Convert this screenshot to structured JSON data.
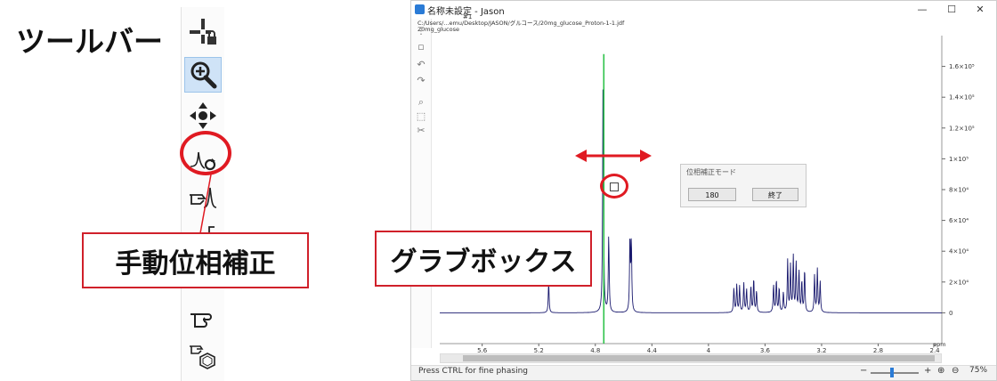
{
  "annotations": {
    "toolbar_label": "ツールバー",
    "manual_phase_label": "手動位相補正",
    "grab_box_label": "グラブボックス"
  },
  "left_toolbar": {
    "buttons": [
      {
        "icon": "crosshair-lock-icon"
      },
      {
        "icon": "zoom-in-icon",
        "active": true
      },
      {
        "icon": "move-arrows-icon"
      },
      {
        "icon": "manual-phase-icon"
      },
      {
        "icon": "hand-peak-icon"
      },
      {
        "icon": "hand-bracket-icon"
      },
      {
        "icon": "hand-point-icon"
      },
      {
        "icon": "hand-hexagon-icon"
      }
    ]
  },
  "window": {
    "title": "名称未設定 - Jason",
    "tab_label": "#1",
    "file_path": "C:/Users/...emu/Desktop/JASON/グルコース/20mg_glucose_Proton-1-1.jdf",
    "sample_name": "20mg_glucose",
    "controls": {
      "minimize": "—",
      "maximize": "☐",
      "close": "✕"
    }
  },
  "dialog": {
    "title": "位相補正モード",
    "value_button": "180",
    "finish_button": "終了"
  },
  "status": {
    "text": "Press CTRL for fine phasing",
    "zoom_minus": "−",
    "zoom_plus": "+",
    "zoom_level": "75%"
  },
  "colors": {
    "spectrum": "#1a1a6e",
    "phase_line": "#2ec24a",
    "annotation_red": "#e01a22"
  },
  "chart_data": {
    "type": "line",
    "xlabel": "ppm",
    "x_reversed": true,
    "xlim": [
      5.9,
      2.35
    ],
    "ylim": [
      -20000,
      180000
    ],
    "x_ticks": [
      {
        "v": 5.6,
        "label": "5.6"
      },
      {
        "v": 5.2,
        "label": "5.2"
      },
      {
        "v": 4.8,
        "label": "4.8"
      },
      {
        "v": 4.4,
        "label": "4.4"
      },
      {
        "v": 4.0,
        "label": "4"
      },
      {
        "v": 3.6,
        "label": "3.6"
      },
      {
        "v": 3.2,
        "label": "3.2"
      },
      {
        "v": 2.8,
        "label": "2.8"
      },
      {
        "v": 2.4,
        "label": "2.4"
      }
    ],
    "y_ticks": [
      {
        "v": 0,
        "label": "0"
      },
      {
        "v": 20000,
        "label": "2×10⁴"
      },
      {
        "v": 40000,
        "label": "4×10⁴"
      },
      {
        "v": 60000,
        "label": "6×10⁴"
      },
      {
        "v": 80000,
        "label": "8×10⁴"
      },
      {
        "v": 100000,
        "label": "1×10⁵"
      },
      {
        "v": 120000,
        "label": "1.2×10⁵"
      },
      {
        "v": 140000,
        "label": "1.4×10⁵"
      },
      {
        "v": 160000,
        "label": "1.6×10⁵"
      }
    ],
    "phase_pivot_ppm": 4.74,
    "peaks": [
      {
        "ppm": 5.13,
        "height": 20000
      },
      {
        "ppm": 4.745,
        "height": 163000
      },
      {
        "ppm": 4.705,
        "height": 50000
      },
      {
        "ppm": 4.555,
        "height": 48000
      },
      {
        "ppm": 4.545,
        "height": 45000
      },
      {
        "ppm": 3.82,
        "height": 16000
      },
      {
        "ppm": 3.8,
        "height": 18000
      },
      {
        "ppm": 3.78,
        "height": 17000
      },
      {
        "ppm": 3.75,
        "height": 19000
      },
      {
        "ppm": 3.73,
        "height": 15000
      },
      {
        "ppm": 3.7,
        "height": 17000
      },
      {
        "ppm": 3.68,
        "height": 22000
      },
      {
        "ppm": 3.66,
        "height": 14000
      },
      {
        "ppm": 3.54,
        "height": 18000
      },
      {
        "ppm": 3.52,
        "height": 21000
      },
      {
        "ppm": 3.5,
        "height": 16000
      },
      {
        "ppm": 3.47,
        "height": 13000
      },
      {
        "ppm": 3.44,
        "height": 34000
      },
      {
        "ppm": 3.42,
        "height": 30000
      },
      {
        "ppm": 3.4,
        "height": 36000
      },
      {
        "ppm": 3.38,
        "height": 32000
      },
      {
        "ppm": 3.36,
        "height": 27000
      },
      {
        "ppm": 3.34,
        "height": 20000
      },
      {
        "ppm": 3.32,
        "height": 28000
      },
      {
        "ppm": 3.25,
        "height": 24000
      },
      {
        "ppm": 3.23,
        "height": 28000
      },
      {
        "ppm": 3.21,
        "height": 20000
      }
    ]
  }
}
